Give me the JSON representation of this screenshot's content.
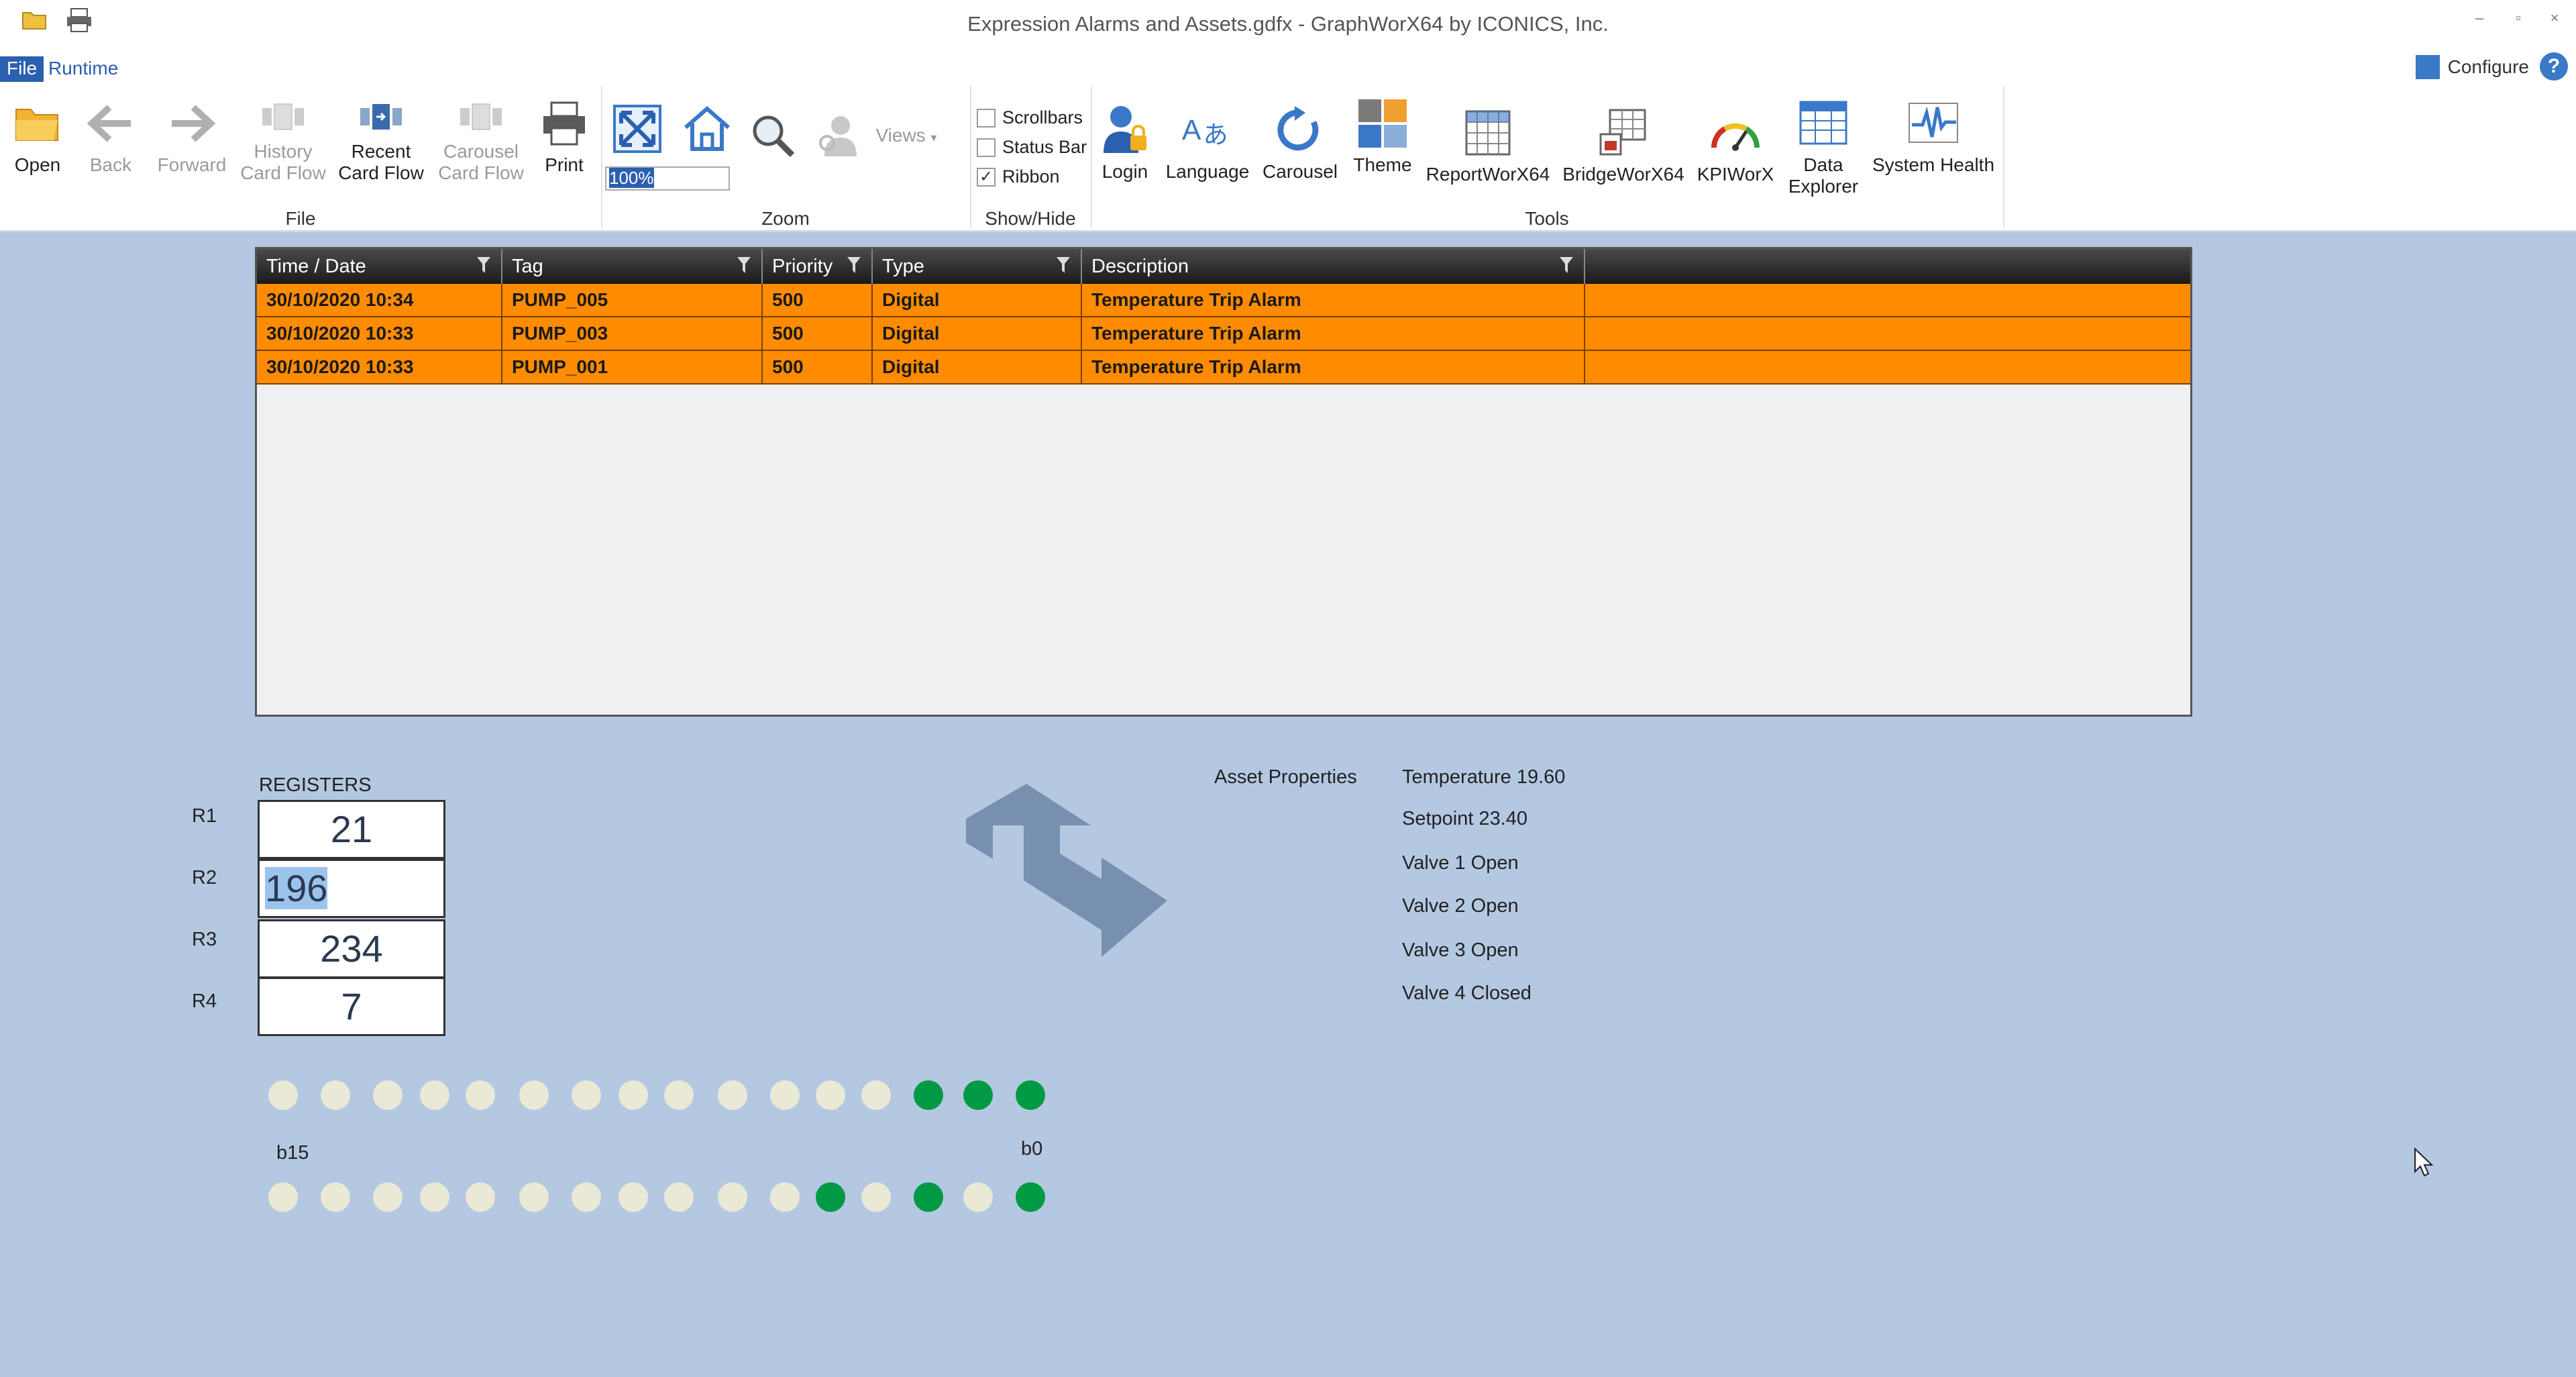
{
  "window": {
    "title": "Expression Alarms and Assets.gdfx - GraphWorX64 by ICONICS, Inc.",
    "minimize": "–",
    "restore": "▫",
    "close": "×"
  },
  "menu": {
    "tabs": [
      {
        "label": "File"
      },
      {
        "label": "Runtime"
      }
    ],
    "configure_label": "Configure",
    "help_label": "?"
  },
  "ribbon": {
    "file_group": {
      "label": "File",
      "open": "Open",
      "back": "Back",
      "forward": "Forward",
      "history_1": "History",
      "history_2": "Card Flow",
      "recent_1": "Recent",
      "recent_2": "Card Flow",
      "carousel_flow_1": "Carousel",
      "carousel_flow_2": "Card Flow",
      "print": "Print"
    },
    "zoom_group": {
      "label": "Zoom",
      "zoom_value": "100%",
      "views": "Views"
    },
    "showhide_group": {
      "label": "Show/Hide",
      "scrollbars": "Scrollbars",
      "status_bar": "Status Bar",
      "ribbon": "Ribbon",
      "ribbon_check": "✓"
    },
    "tools_group": {
      "label": "Tools",
      "login": "Login",
      "language": "Language",
      "carousel": "Carousel",
      "theme": "Theme",
      "reportworx": "ReportWorX64",
      "bridgeworx": "BridgeWorX64",
      "kpiworx": "KPIWorX",
      "data_explorer_1": "Data",
      "data_explorer_2": "Explorer",
      "system_health": "System Health"
    }
  },
  "alarm_table": {
    "columns": [
      "Time / Date",
      "Tag",
      "Priority",
      "Type",
      "Description"
    ],
    "rows": [
      {
        "time": "30/10/2020 10:34",
        "tag": "PUMP_005",
        "priority": "500",
        "type": "Digital",
        "description": "Temperature Trip Alarm"
      },
      {
        "time": "30/10/2020 10:33",
        "tag": "PUMP_003",
        "priority": "500",
        "type": "Digital",
        "description": "Temperature Trip Alarm"
      },
      {
        "time": "30/10/2020 10:33",
        "tag": "PUMP_001",
        "priority": "500",
        "type": "Digital",
        "description": "Temperature Trip Alarm"
      }
    ],
    "row_color": "#ff8c00"
  },
  "registers": {
    "title": "REGISTERS",
    "items": [
      {
        "label": "R1",
        "value": "21"
      },
      {
        "label": "R2",
        "value": "196"
      },
      {
        "label": "R3",
        "value": "234"
      },
      {
        "label": "R4",
        "value": "7"
      }
    ]
  },
  "asset": {
    "label": "Asset Properties",
    "properties": [
      "Temperature 19.60",
      "Setpoint 23.40",
      "Valve 1 Open",
      "Valve 2 Open",
      "Valve 3 Open",
      "Valve 4 Closed"
    ]
  },
  "bits": {
    "high_label": "b15",
    "low_label": "b0",
    "row1": [
      0,
      0,
      0,
      0,
      0,
      0,
      0,
      0,
      0,
      0,
      0,
      0,
      0,
      1,
      1,
      1
    ],
    "row2": [
      0,
      0,
      0,
      0,
      0,
      0,
      0,
      0,
      0,
      0,
      0,
      1,
      0,
      1,
      0,
      1
    ],
    "on_color": "#009a44",
    "off_color": "#e9e9d6"
  }
}
